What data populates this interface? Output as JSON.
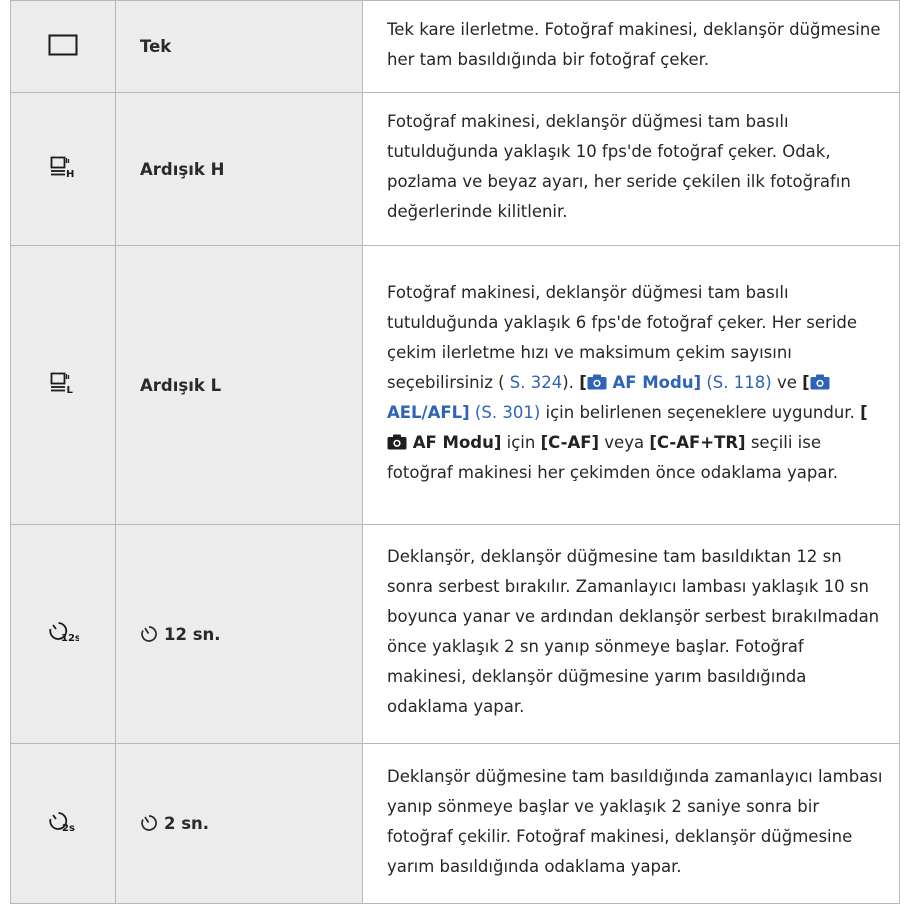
{
  "rows": [
    {
      "icon": "single-frame-icon",
      "name": "Tek",
      "desc": {
        "text": "Tek kare ilerletme. Fotoğraf makinesi, deklanşör düğmesine her tam basıldığında bir fotoğraf çeker."
      }
    },
    {
      "icon": "sequential-high-icon",
      "name": "Ardışık H",
      "desc": {
        "text": "Fotoğraf makinesi, deklanşör düğmesi tam basılı tutulduğunda yaklaşık 10 fps'de fotoğraf çeker. Odak, pozlama ve beyaz ayarı, her seride çekilen ilk fotoğrafın değerlerinde kilitlenir."
      }
    },
    {
      "icon": "sequential-low-icon",
      "name": "Ardışık L",
      "desc": {
        "p1": "Fotoğraf makinesi, deklanşör düğmesi tam basılı tutulduğunda yaklaşık 6 fps'de fotoğraf çeker. Her seride çekim ilerletme hızı ve maksimum çekim sayısını seçebilirsiniz (",
        "ref1": " S. 324",
        "p2": "). ",
        "b1_open": "[",
        "b1_label": " AF Modu]",
        "ref2": " (S. 118)",
        "p3": " ve ",
        "b2_open": "[",
        "b2_label": " AEL/AFL]",
        "ref3": " (S. 301)",
        "p4": " için belirlenen seçeneklere uygundur. ",
        "b3_open": "[",
        "b3_label": " AF Modu]",
        "p5": " için ",
        "b4": "[C-AF]",
        "p6": " veya ",
        "b5": "[C-AF+TR]",
        "p7": " seçili ise fotoğraf makinesi her çekimden önce odaklama yapar."
      }
    },
    {
      "icon": "self-timer-12s-icon",
      "name": "12 sn.",
      "desc": {
        "text": "Deklanşör, deklanşör düğmesine tam basıldıktan 12 sn sonra serbest bırakılır. Zamanlayıcı lambası yaklaşık 10 sn boyunca yanar ve ardından deklanşör serbest bırakılmadan önce yaklaşık 2 sn yanıp sönmeye başlar. Fotoğraf makinesi, deklanşör düğmesine yarım basıldığında odaklama yapar."
      }
    },
    {
      "icon": "self-timer-2s-icon",
      "name": "2 sn.",
      "desc": {
        "text": "Deklanşör düğmesine tam basıldığında zamanlayıcı lambası yanıp sönmeye başlar ve yaklaşık 2 saniye sonra bir fotoğraf çekilir. Fotoğraf makinesi, deklanşör düğmesine yarım basıldığında odaklama yapar."
      }
    }
  ],
  "icon_labels": {
    "high": "H",
    "low": "L",
    "timer12": "12s",
    "timer2": "2s"
  },
  "colors": {
    "link": "#2e63b8",
    "left_column_bg": "#ececec",
    "border": "#b8b8b8"
  }
}
